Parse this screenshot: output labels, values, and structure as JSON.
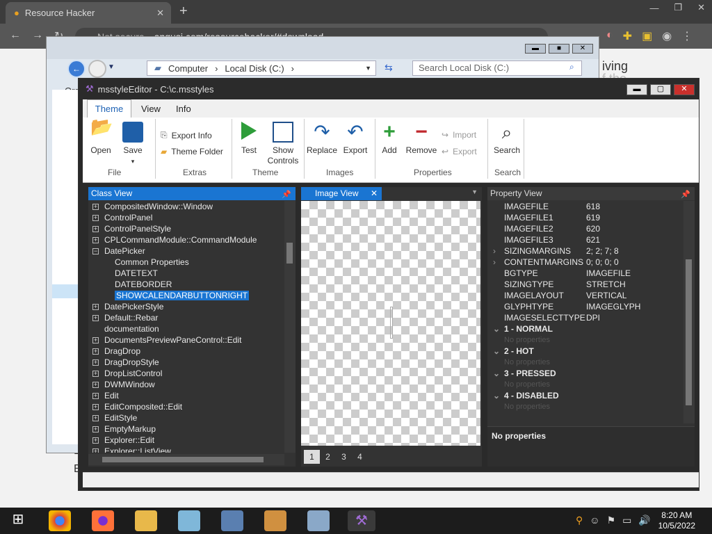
{
  "browser": {
    "tab_title": "Resource Hacker",
    "omnibox_security": "Not secure",
    "omnibox_url": "angusj.com/resourcehacker/#download"
  },
  "web": {
    "text1": "iving",
    "text2": "f the",
    "text3": "E",
    "text4": "E"
  },
  "explorer": {
    "path": [
      "Computer",
      "Local Disk (C:)"
    ],
    "search_placeholder": "Search Local Disk (C:)",
    "organize": "Org"
  },
  "window": {
    "title": "msstyleEditor - C:\\c.msstyles"
  },
  "menu": {
    "theme": "Theme",
    "view": "View",
    "info": "Info"
  },
  "ribbon": {
    "open": "Open",
    "save": "Save",
    "file_group": "File",
    "export_info": "Export Info",
    "theme_folder": "Theme Folder",
    "extras_group": "Extras",
    "test": "Test",
    "show_controls_1": "Show",
    "show_controls_2": "Controls",
    "theme_group": "Theme",
    "replace": "Replace",
    "export": "Export",
    "images_group": "Images",
    "add": "Add",
    "remove": "Remove",
    "import": "Import",
    "export_prop": "Export",
    "properties_group": "Properties",
    "search": "Search",
    "search_group": "Search"
  },
  "classview": {
    "title": "Class View",
    "items": [
      {
        "label": "CompositedWindow::Window",
        "type": "node"
      },
      {
        "label": "ControlPanel",
        "type": "node"
      },
      {
        "label": "ControlPanelStyle",
        "type": "node"
      },
      {
        "label": "CPLCommandModule::CommandModule",
        "type": "node"
      },
      {
        "label": "DatePicker",
        "type": "open"
      },
      {
        "label": "Common Properties",
        "type": "child"
      },
      {
        "label": "DATETEXT",
        "type": "child"
      },
      {
        "label": "DATEBORDER",
        "type": "child"
      },
      {
        "label": "SHOWCALENDARBUTTONRIGHT",
        "type": "selected"
      },
      {
        "label": "DatePickerStyle",
        "type": "node"
      },
      {
        "label": "Default::Rebar",
        "type": "node"
      },
      {
        "label": "documentation",
        "type": "leaf"
      },
      {
        "label": "DocumentsPreviewPaneControl::Edit",
        "type": "node"
      },
      {
        "label": "DragDrop",
        "type": "node"
      },
      {
        "label": "DragDropStyle",
        "type": "node"
      },
      {
        "label": "DropListControl",
        "type": "node"
      },
      {
        "label": "DWMWindow",
        "type": "node"
      },
      {
        "label": "Edit",
        "type": "node"
      },
      {
        "label": "EditComposited::Edit",
        "type": "node"
      },
      {
        "label": "EditStyle",
        "type": "node"
      },
      {
        "label": "EmptyMarkup",
        "type": "node"
      },
      {
        "label": "Explorer::Edit",
        "type": "node"
      },
      {
        "label": "Explorer::ListView",
        "type": "node"
      }
    ]
  },
  "imageview": {
    "title": "Image View",
    "pages": [
      "1",
      "2",
      "3",
      "4"
    ]
  },
  "propview": {
    "title": "Property View",
    "rows": [
      {
        "k": "IMAGEFILE",
        "v": "618",
        "t": "row"
      },
      {
        "k": "IMAGEFILE1",
        "v": "619",
        "t": "row"
      },
      {
        "k": "IMAGEFILE2",
        "v": "620",
        "t": "row"
      },
      {
        "k": "IMAGEFILE3",
        "v": "621",
        "t": "row"
      },
      {
        "k": "SIZINGMARGINS",
        "v": "2; 2; 7; 8",
        "t": "exp"
      },
      {
        "k": "CONTENTMARGINS",
        "v": "0; 0; 0; 0",
        "t": "exp"
      },
      {
        "k": "BGTYPE",
        "v": "IMAGEFILE",
        "t": "row"
      },
      {
        "k": "SIZINGTYPE",
        "v": "STRETCH",
        "t": "row"
      },
      {
        "k": "IMAGELAYOUT",
        "v": "VERTICAL",
        "t": "row"
      },
      {
        "k": "GLYPHTYPE",
        "v": "IMAGEGLYPH",
        "t": "row"
      },
      {
        "k": "IMAGESELECTTYPE",
        "v": "DPI",
        "t": "row"
      },
      {
        "k": "1 - NORMAL",
        "v": "",
        "t": "sec"
      },
      {
        "k": "No properties",
        "v": "",
        "t": "np"
      },
      {
        "k": "2 - HOT",
        "v": "",
        "t": "sec"
      },
      {
        "k": "No properties",
        "v": "",
        "t": "np"
      },
      {
        "k": "3 - PRESSED",
        "v": "",
        "t": "sec"
      },
      {
        "k": "No properties",
        "v": "",
        "t": "np"
      },
      {
        "k": "4 - DISABLED",
        "v": "",
        "t": "sec"
      },
      {
        "k": "No properties",
        "v": "",
        "t": "np"
      }
    ],
    "bottom": "No properties"
  },
  "taskbar": {
    "time": "8:20 AM",
    "date": "10/5/2022"
  },
  "colors": {
    "accent": "#1a75d2",
    "panel": "#333333"
  }
}
